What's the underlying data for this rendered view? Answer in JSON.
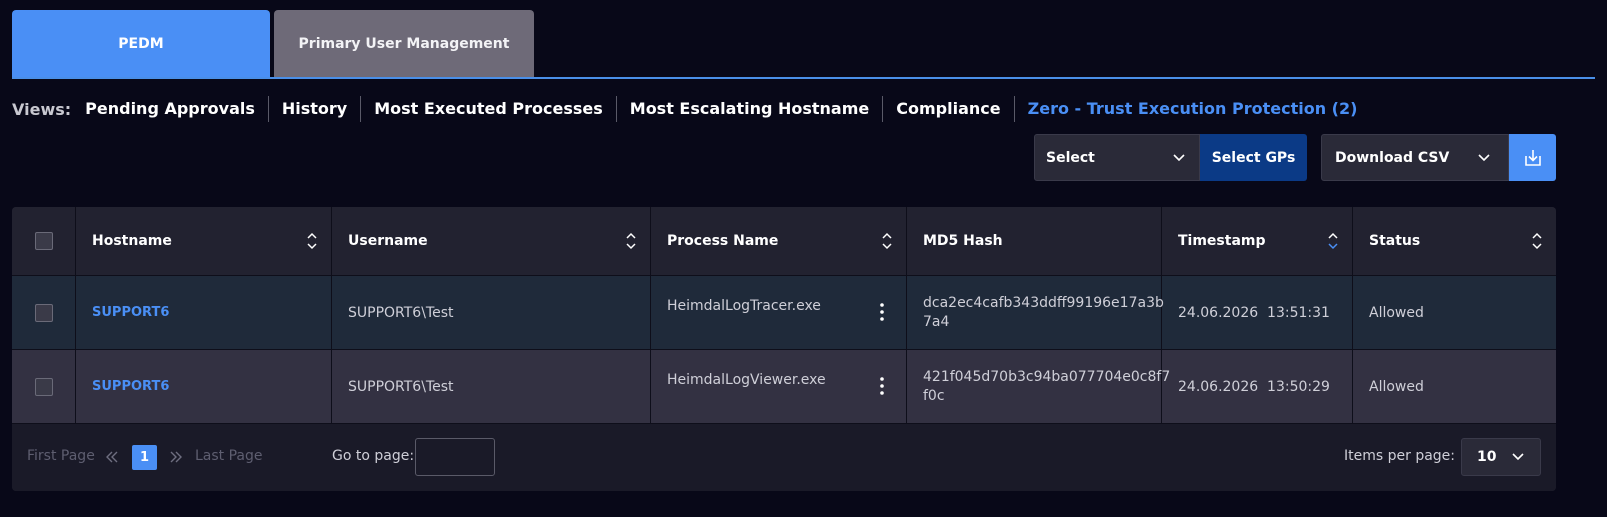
{
  "tabs": [
    {
      "label": "PEDM",
      "active": true
    },
    {
      "label": "Primary User Management",
      "active": false
    }
  ],
  "views": {
    "label": "Views:",
    "items": [
      "Pending Approvals",
      "History",
      "Most Executed Processes",
      "Most Escalating Hostname",
      "Compliance",
      "Zero - Trust Execution Protection (2)"
    ],
    "active_index": 5
  },
  "toolbar": {
    "select_label": "Select",
    "select_gps_label": "Select GPs",
    "download_csv_label": "Download CSV",
    "download_icon": "download-icon"
  },
  "table": {
    "columns": [
      "Hostname",
      "Username",
      "Process Name",
      "MD5 Hash",
      "Timestamp",
      "Status"
    ],
    "rows": [
      {
        "hostname": "SUPPORT6",
        "username": "SUPPORT6\\Test",
        "process": "HeimdalLogTracer.exe",
        "hash_line1": "dca2ec4cafb343ddff99196e17a3b",
        "hash_line2": "7a4",
        "timestamp": "24.06.2026  13:51:31",
        "status": "Allowed"
      },
      {
        "hostname": "SUPPORT6",
        "username": "SUPPORT6\\Test",
        "process": "HeimdalLogViewer.exe",
        "hash_line1": "421f045d70b3c94ba077704e0c8f7",
        "hash_line2": "f0c",
        "timestamp": "24.06.2026  13:50:29",
        "status": "Allowed"
      }
    ]
  },
  "pagination": {
    "first_label": "First Page",
    "last_label": "Last Page",
    "current_page": "1",
    "goto_label": "Go to page:",
    "goto_value": "",
    "items_per_page_label": "Items per page:",
    "items_per_page_value": "10"
  },
  "colors": {
    "accent": "#4a8ff5",
    "background": "#080818",
    "select_gps": "#0b3a86"
  }
}
